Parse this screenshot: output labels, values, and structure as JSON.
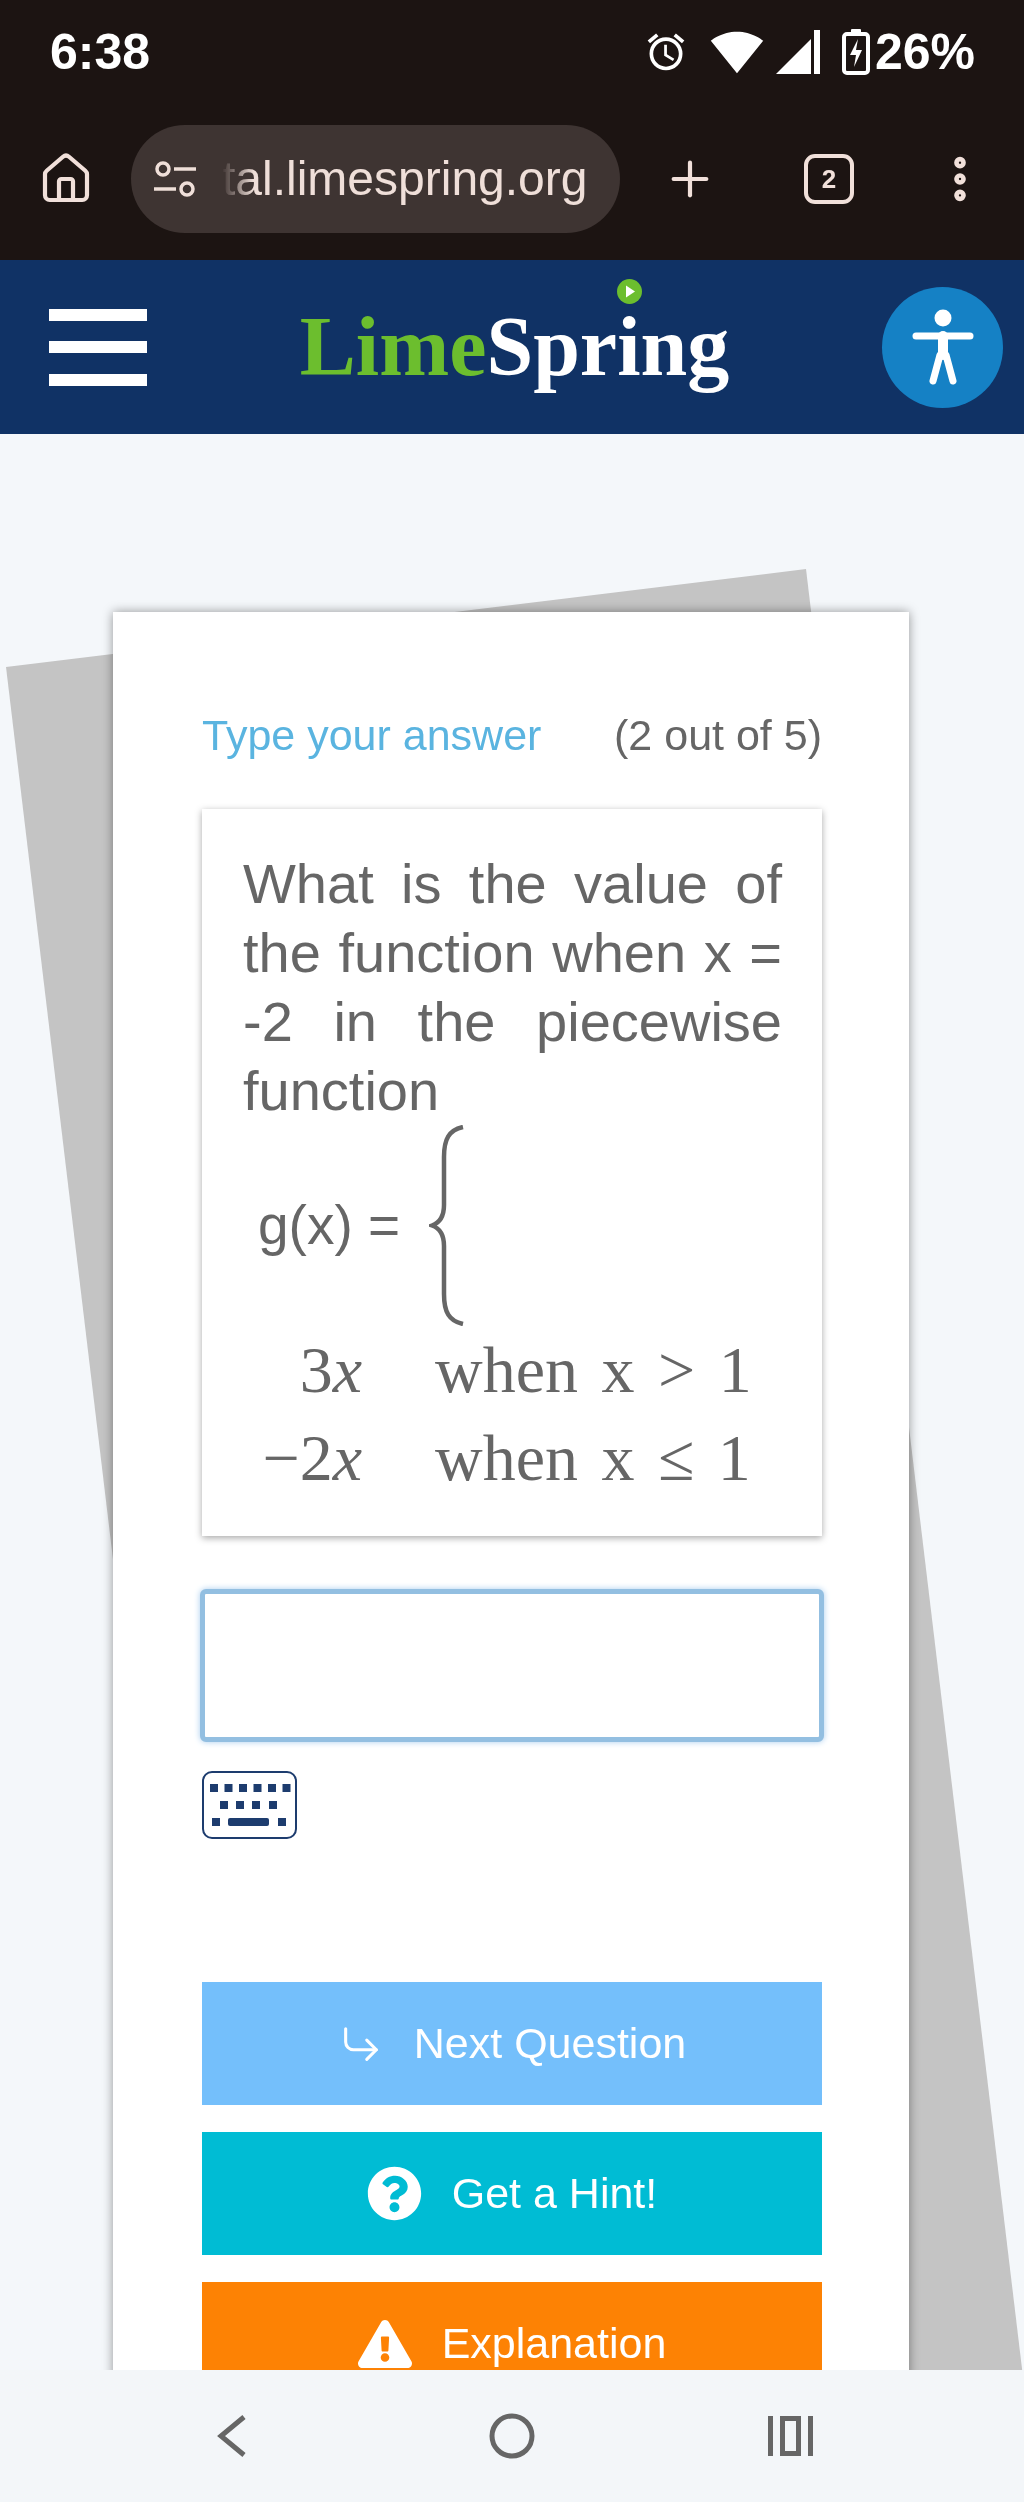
{
  "status_bar": {
    "time": "6:38",
    "battery": "26%"
  },
  "browser": {
    "url": "tal.limespring.org",
    "tab_count": "2"
  },
  "header": {
    "logo": {
      "first": "Lime",
      "second": "Spring"
    }
  },
  "question": {
    "instruction": "Type your answer",
    "counter": "(2 out of 5)",
    "text": "What is the value of the function when x = -2 in the piecewise function",
    "formula": {
      "lhs": "g(x) =",
      "cases": [
        {
          "coefficient": "3",
          "variable": "x",
          "condition": "when x > 1"
        },
        {
          "coefficient": "−2",
          "variable": "x",
          "condition": "when x ≤ 1"
        }
      ]
    }
  },
  "buttons": [
    {
      "kind": "next",
      "label": "Next Question"
    },
    {
      "kind": "hint",
      "label": "Get a Hint!"
    },
    {
      "kind": "explanation",
      "label": "Explanation"
    }
  ]
}
